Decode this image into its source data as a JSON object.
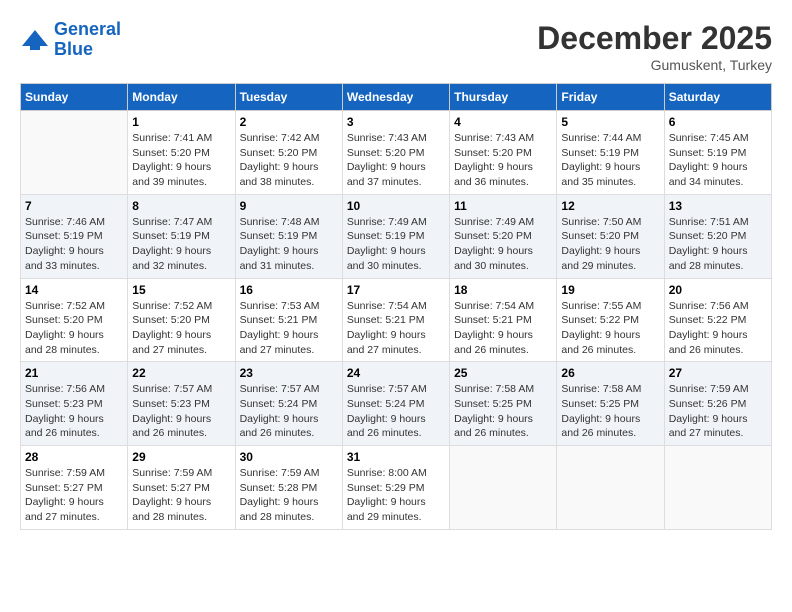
{
  "logo": {
    "line1": "General",
    "line2": "Blue"
  },
  "title": "December 2025",
  "location": "Gumuskent, Turkey",
  "days_header": [
    "Sunday",
    "Monday",
    "Tuesday",
    "Wednesday",
    "Thursday",
    "Friday",
    "Saturday"
  ],
  "weeks": [
    [
      {
        "day": "",
        "sunrise": "",
        "sunset": "",
        "daylight": "",
        "empty": true
      },
      {
        "day": "1",
        "sunrise": "Sunrise: 7:41 AM",
        "sunset": "Sunset: 5:20 PM",
        "daylight": "Daylight: 9 hours and 39 minutes."
      },
      {
        "day": "2",
        "sunrise": "Sunrise: 7:42 AM",
        "sunset": "Sunset: 5:20 PM",
        "daylight": "Daylight: 9 hours and 38 minutes."
      },
      {
        "day": "3",
        "sunrise": "Sunrise: 7:43 AM",
        "sunset": "Sunset: 5:20 PM",
        "daylight": "Daylight: 9 hours and 37 minutes."
      },
      {
        "day": "4",
        "sunrise": "Sunrise: 7:43 AM",
        "sunset": "Sunset: 5:20 PM",
        "daylight": "Daylight: 9 hours and 36 minutes."
      },
      {
        "day": "5",
        "sunrise": "Sunrise: 7:44 AM",
        "sunset": "Sunset: 5:19 PM",
        "daylight": "Daylight: 9 hours and 35 minutes."
      },
      {
        "day": "6",
        "sunrise": "Sunrise: 7:45 AM",
        "sunset": "Sunset: 5:19 PM",
        "daylight": "Daylight: 9 hours and 34 minutes."
      }
    ],
    [
      {
        "day": "7",
        "sunrise": "Sunrise: 7:46 AM",
        "sunset": "Sunset: 5:19 PM",
        "daylight": "Daylight: 9 hours and 33 minutes."
      },
      {
        "day": "8",
        "sunrise": "Sunrise: 7:47 AM",
        "sunset": "Sunset: 5:19 PM",
        "daylight": "Daylight: 9 hours and 32 minutes."
      },
      {
        "day": "9",
        "sunrise": "Sunrise: 7:48 AM",
        "sunset": "Sunset: 5:19 PM",
        "daylight": "Daylight: 9 hours and 31 minutes."
      },
      {
        "day": "10",
        "sunrise": "Sunrise: 7:49 AM",
        "sunset": "Sunset: 5:19 PM",
        "daylight": "Daylight: 9 hours and 30 minutes."
      },
      {
        "day": "11",
        "sunrise": "Sunrise: 7:49 AM",
        "sunset": "Sunset: 5:20 PM",
        "daylight": "Daylight: 9 hours and 30 minutes."
      },
      {
        "day": "12",
        "sunrise": "Sunrise: 7:50 AM",
        "sunset": "Sunset: 5:20 PM",
        "daylight": "Daylight: 9 hours and 29 minutes."
      },
      {
        "day": "13",
        "sunrise": "Sunrise: 7:51 AM",
        "sunset": "Sunset: 5:20 PM",
        "daylight": "Daylight: 9 hours and 28 minutes."
      }
    ],
    [
      {
        "day": "14",
        "sunrise": "Sunrise: 7:52 AM",
        "sunset": "Sunset: 5:20 PM",
        "daylight": "Daylight: 9 hours and 28 minutes."
      },
      {
        "day": "15",
        "sunrise": "Sunrise: 7:52 AM",
        "sunset": "Sunset: 5:20 PM",
        "daylight": "Daylight: 9 hours and 27 minutes."
      },
      {
        "day": "16",
        "sunrise": "Sunrise: 7:53 AM",
        "sunset": "Sunset: 5:21 PM",
        "daylight": "Daylight: 9 hours and 27 minutes."
      },
      {
        "day": "17",
        "sunrise": "Sunrise: 7:54 AM",
        "sunset": "Sunset: 5:21 PM",
        "daylight": "Daylight: 9 hours and 27 minutes."
      },
      {
        "day": "18",
        "sunrise": "Sunrise: 7:54 AM",
        "sunset": "Sunset: 5:21 PM",
        "daylight": "Daylight: 9 hours and 26 minutes."
      },
      {
        "day": "19",
        "sunrise": "Sunrise: 7:55 AM",
        "sunset": "Sunset: 5:22 PM",
        "daylight": "Daylight: 9 hours and 26 minutes."
      },
      {
        "day": "20",
        "sunrise": "Sunrise: 7:56 AM",
        "sunset": "Sunset: 5:22 PM",
        "daylight": "Daylight: 9 hours and 26 minutes."
      }
    ],
    [
      {
        "day": "21",
        "sunrise": "Sunrise: 7:56 AM",
        "sunset": "Sunset: 5:23 PM",
        "daylight": "Daylight: 9 hours and 26 minutes."
      },
      {
        "day": "22",
        "sunrise": "Sunrise: 7:57 AM",
        "sunset": "Sunset: 5:23 PM",
        "daylight": "Daylight: 9 hours and 26 minutes."
      },
      {
        "day": "23",
        "sunrise": "Sunrise: 7:57 AM",
        "sunset": "Sunset: 5:24 PM",
        "daylight": "Daylight: 9 hours and 26 minutes."
      },
      {
        "day": "24",
        "sunrise": "Sunrise: 7:57 AM",
        "sunset": "Sunset: 5:24 PM",
        "daylight": "Daylight: 9 hours and 26 minutes."
      },
      {
        "day": "25",
        "sunrise": "Sunrise: 7:58 AM",
        "sunset": "Sunset: 5:25 PM",
        "daylight": "Daylight: 9 hours and 26 minutes."
      },
      {
        "day": "26",
        "sunrise": "Sunrise: 7:58 AM",
        "sunset": "Sunset: 5:25 PM",
        "daylight": "Daylight: 9 hours and 26 minutes."
      },
      {
        "day": "27",
        "sunrise": "Sunrise: 7:59 AM",
        "sunset": "Sunset: 5:26 PM",
        "daylight": "Daylight: 9 hours and 27 minutes."
      }
    ],
    [
      {
        "day": "28",
        "sunrise": "Sunrise: 7:59 AM",
        "sunset": "Sunset: 5:27 PM",
        "daylight": "Daylight: 9 hours and 27 minutes."
      },
      {
        "day": "29",
        "sunrise": "Sunrise: 7:59 AM",
        "sunset": "Sunset: 5:27 PM",
        "daylight": "Daylight: 9 hours and 28 minutes."
      },
      {
        "day": "30",
        "sunrise": "Sunrise: 7:59 AM",
        "sunset": "Sunset: 5:28 PM",
        "daylight": "Daylight: 9 hours and 28 minutes."
      },
      {
        "day": "31",
        "sunrise": "Sunrise: 8:00 AM",
        "sunset": "Sunset: 5:29 PM",
        "daylight": "Daylight: 9 hours and 29 minutes."
      },
      {
        "day": "",
        "sunrise": "",
        "sunset": "",
        "daylight": "",
        "empty": true
      },
      {
        "day": "",
        "sunrise": "",
        "sunset": "",
        "daylight": "",
        "empty": true
      },
      {
        "day": "",
        "sunrise": "",
        "sunset": "",
        "daylight": "",
        "empty": true
      }
    ]
  ]
}
